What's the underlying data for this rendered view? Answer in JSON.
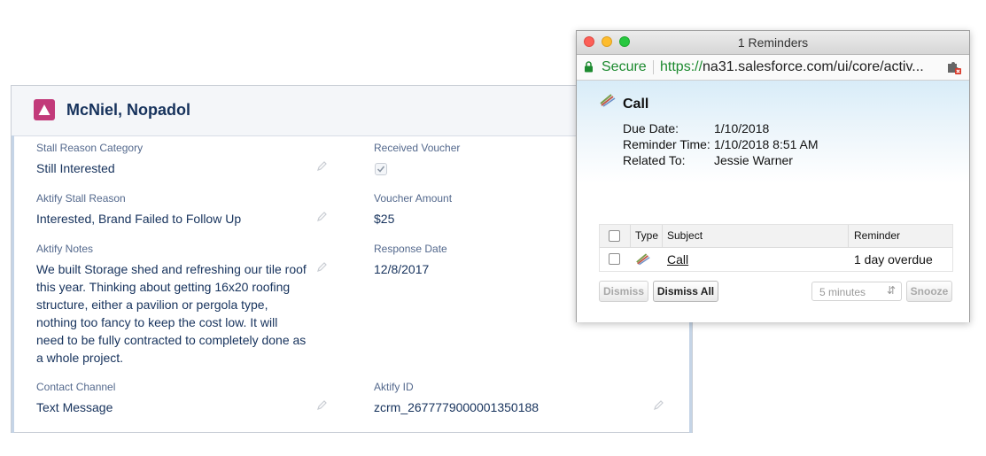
{
  "record": {
    "title": "McNiel, Nopadol",
    "icon": "record-triangle-icon",
    "icon_color": "#c23a7a",
    "fields": {
      "stall_reason_category": {
        "label": "Stall Reason Category",
        "value": "Still Interested"
      },
      "received_voucher": {
        "label": "Received Voucher",
        "checked": true
      },
      "aktify_stall_reason": {
        "label": "Aktify Stall Reason",
        "value": "Interested, Brand Failed to Follow Up"
      },
      "voucher_amount": {
        "label": "Voucher Amount",
        "value": "$25"
      },
      "aktify_notes": {
        "label": "Aktify Notes",
        "lines": [
          "We built Storage shed and refreshing our tile roof",
          "this year. Thinking about getting 16x20 roofing",
          "structure, either a pavilion or pergola type,",
          "nothing too fancy to keep the cost low. It will",
          "need to be fully contracted to completely done as",
          "a whole project."
        ]
      },
      "response_date": {
        "label": "Response Date",
        "value": "12/8/2017"
      },
      "contact_channel": {
        "label": "Contact Channel",
        "value": "Text Message"
      },
      "aktify_id": {
        "label": "Aktify ID",
        "value": "zcrm_2677779000001350188"
      }
    }
  },
  "popup": {
    "window_title": "1 Reminders",
    "secure_label": "Secure",
    "url_scheme": "https://",
    "url_host": "na31.salesforce.com",
    "url_path": "/ui/core/activ...",
    "heading": "Call",
    "details": [
      {
        "label": "Due Date:",
        "value": "1/10/2018"
      },
      {
        "label": "Reminder Time:",
        "value": "1/10/2018 8:51 AM"
      },
      {
        "label": "Related To:",
        "value": "Jessie Warner"
      }
    ],
    "table": {
      "headers": {
        "type": "Type",
        "subject": "Subject",
        "reminder": "Reminder"
      },
      "rows": [
        {
          "subject": "Call",
          "reminder": "1 day overdue",
          "checked": false
        }
      ]
    },
    "buttons": {
      "dismiss": "Dismiss",
      "dismiss_all": "Dismiss All",
      "snooze": "Snooze"
    },
    "snooze_select": {
      "value": "5 minutes"
    },
    "colors": {
      "secure_green": "#1c8a2f"
    }
  }
}
